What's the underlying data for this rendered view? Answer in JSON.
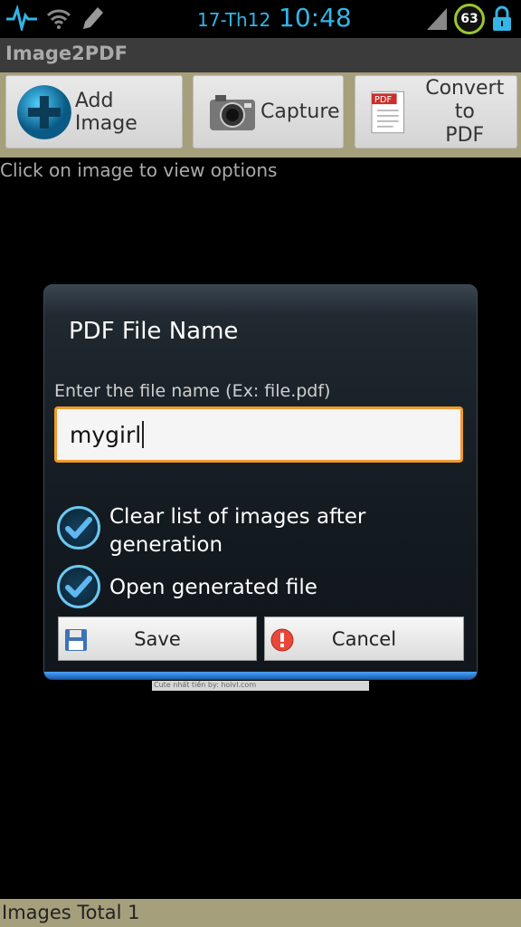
{
  "status_bar": {
    "date": "17-Th12",
    "time": "10:48",
    "battery": "63",
    "icons": [
      "pulse-icon",
      "wifi-icon",
      "pencil-icon",
      "signal-icon",
      "battery-icon",
      "lock-icon"
    ]
  },
  "app": {
    "title": "Image2PDF"
  },
  "toolbar": {
    "add_label": "Add Image",
    "capture_label": "Capture",
    "convert_label_line1": "Convert to",
    "convert_label_line2": "PDF"
  },
  "hint": "Click on image to view options",
  "photo_caption": "Cute nhất tiền by: hoivl.com",
  "dialog": {
    "title": "PDF File Name",
    "label": "Enter the file name (Ex: file.pdf)",
    "input_value": "mygirl",
    "option1_label": "Clear list of images after generation",
    "option1_checked": true,
    "option2_label": "Open generated file",
    "option2_checked": true,
    "save_label": "Save",
    "cancel_label": "Cancel"
  },
  "footer": {
    "images_total": "Images Total 1"
  },
  "colors": {
    "accent": "#33b5e5",
    "bar": "#a59f7c",
    "focus": "#f19a2c"
  }
}
